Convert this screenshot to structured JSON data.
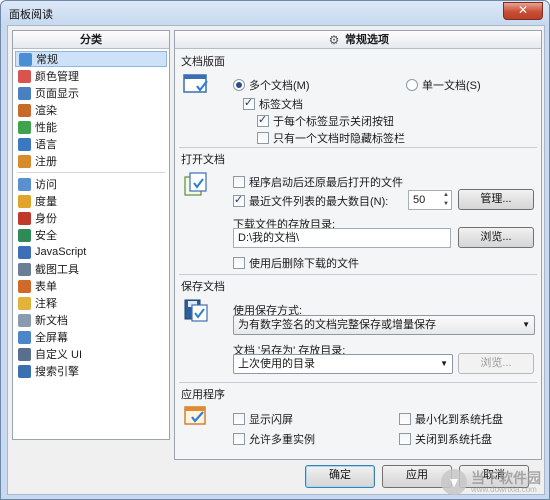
{
  "window": {
    "title": "面板阅读"
  },
  "sidebar": {
    "header": "分类",
    "items_group1": [
      {
        "label": "常规",
        "icon": "general-icon",
        "color": "#4a8ed6"
      },
      {
        "label": "颜色管理",
        "icon": "color-icon",
        "color": "#d9534f"
      },
      {
        "label": "页面显示",
        "icon": "page-icon",
        "color": "#4a7fc0"
      },
      {
        "label": "渲染",
        "icon": "render-icon",
        "color": "#c86a2a"
      },
      {
        "label": "性能",
        "icon": "performance-icon",
        "color": "#3fa34d"
      },
      {
        "label": "语言",
        "icon": "language-icon",
        "color": "#3a78c2"
      },
      {
        "label": "注册",
        "icon": "register-icon",
        "color": "#d98a2b"
      }
    ],
    "items_group2": [
      {
        "label": "访问",
        "icon": "access-icon",
        "color": "#5a8fd0"
      },
      {
        "label": "度量",
        "icon": "measure-icon",
        "color": "#e0a42a"
      },
      {
        "label": "身份",
        "icon": "identity-icon",
        "color": "#c0392b"
      },
      {
        "label": "安全",
        "icon": "security-icon",
        "color": "#2e8b57"
      },
      {
        "label": "JavaScript",
        "icon": "javascript-icon",
        "color": "#3d6fb6"
      },
      {
        "label": "截图工具",
        "icon": "screenshot-icon",
        "color": "#6a7f96"
      },
      {
        "label": "表单",
        "icon": "form-icon",
        "color": "#d06a2a"
      },
      {
        "label": "注释",
        "icon": "comment-icon",
        "color": "#e2b33a"
      },
      {
        "label": "新文档",
        "icon": "new-doc-icon",
        "color": "#8a9ab0"
      },
      {
        "label": "全屏幕",
        "icon": "fullscreen-icon",
        "color": "#4a86c8"
      },
      {
        "label": "自定义 UI",
        "icon": "custom-ui-icon",
        "color": "#5a6f8e"
      },
      {
        "label": "搜索引擎",
        "icon": "search-engine-icon",
        "color": "#3a6fb0"
      }
    ]
  },
  "main": {
    "header": "常规选项",
    "doc_layout": {
      "title": "文档版面",
      "radio_multi": "多个文档(M)",
      "radio_single": "单一文档(S)",
      "tab_docs": "标签文档",
      "close_btn_each_tab": "于每个标签显示关闭按钮",
      "hide_tab_bar_single": "只有一个文档时隐藏标签栏"
    },
    "open_docs": {
      "title": "打开文档",
      "reopen_last": "程序启动后还原最后打开的文件",
      "max_recent": "最近文件列表的最大数目(N):",
      "max_recent_value": "50",
      "manage_button": "管理...",
      "download_dir_label": "下载文件的存放目录:",
      "download_dir_value": "D:\\我的文档\\",
      "browse_button": "浏览...",
      "delete_after_use": "使用后删除下载的文件"
    },
    "save_docs": {
      "title": "保存文档",
      "save_method_label": "使用保存方式:",
      "save_method_value": "为有数字签名的文档完整保存或增量保存",
      "save_as_label": "文档 '另存为' 存放目录:",
      "save_as_value": "上次使用的目录",
      "browse_button": "浏览..."
    },
    "application": {
      "title": "应用程序",
      "show_splash": "显示闪屏",
      "allow_multi_instance": "允许多重实例",
      "minimize_to_tray": "最小化到系统托盘",
      "close_to_tray": "关闭到系统托盘"
    }
  },
  "footer": {
    "ok": "确定",
    "apply": "应用",
    "cancel": "取消"
  },
  "watermark": {
    "brand": "当下软件园",
    "url": "www.downxia.com"
  }
}
